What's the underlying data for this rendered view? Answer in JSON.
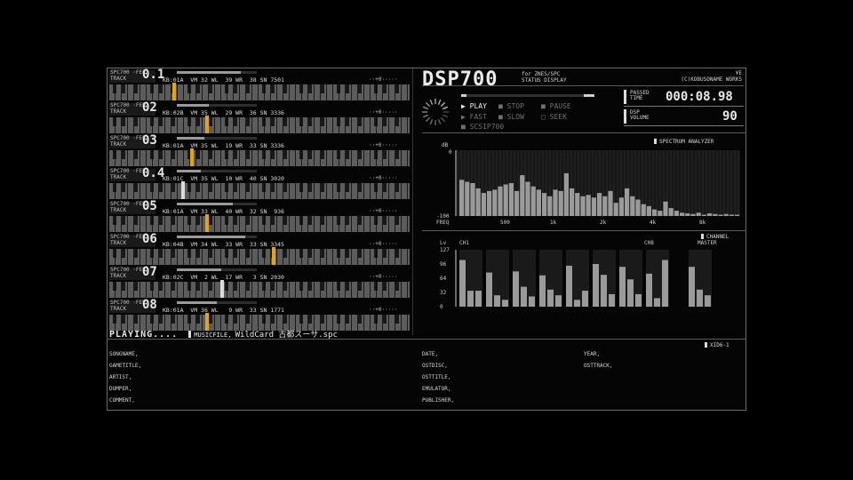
{
  "app": {
    "title": "DSP700",
    "subtitle_line1": "for ZNES/SPC",
    "subtitle_line2": "STATUS DISPLAY",
    "corner_line1": "¥E",
    "corner_line2": "(C)KOBUSONAME WORKS"
  },
  "channels": [
    {
      "label_a": "SPC700 ·FEE",
      "label_b": "TRACK",
      "num": "0.1",
      "info": "KB:01A  VM 32 WL  39 WR  38 SN 7501",
      "pan": "··+0·····",
      "level": 0.8,
      "note_color": "#e3a21a",
      "note_pos": 0.21
    },
    {
      "label_a": "SPC700 ·FEE",
      "label_b": "TRACK",
      "num": "02",
      "info": "KB:02B  VM 35 WL  29 WR  36 SN 3336",
      "pan": "··+0·····",
      "level": 0.4,
      "note_color": "#e3a21a",
      "note_pos": 0.32
    },
    {
      "label_a": "SPC700 ·FEE",
      "label_b": "TRACK",
      "num": "03",
      "info": "KB:01A  VM 35 WL  19 WR  33 SN 3336",
      "pan": "··+0·····",
      "level": 0.35,
      "note_color": "#e3a21a",
      "note_pos": 0.27
    },
    {
      "label_a": "SPC700 ·FEE",
      "label_b": "TRACK",
      "num": "0.4",
      "info": "KB:01C  VM 35 WL  10 WR  40 SN 3020",
      "pan": "··+0·····",
      "level": 0.3,
      "note_color": "#dcdcdc",
      "note_pos": 0.24
    },
    {
      "label_a": "SPC700 ·FEE",
      "label_b": "TRACK",
      "num": "05",
      "info": "KB:01A  VM 33 WL  40 WR  32 SN  936",
      "pan": "··+0·····",
      "level": 0.7,
      "note_color": "#e3a21a",
      "note_pos": 0.32
    },
    {
      "label_a": "SPC700 ·FEE",
      "label_b": "TRACK",
      "num": "06",
      "info": "KB:04B  VM 34 WL  33 WR  33 SN 3345",
      "pan": "··+0·····",
      "level": 0.85,
      "note_color": "#e3a21a",
      "note_pos": 0.54
    },
    {
      "label_a": "SPC700 ·FEE",
      "label_b": "TRACK",
      "num": "07",
      "info": "KB:02C  VM  2 WL  17 WR   3 SN 2030",
      "pan": "··+0·····",
      "level": 0.55,
      "note_color": "#dcdcdc",
      "note_pos": 0.37
    },
    {
      "label_a": "SPC700 ·FEE",
      "label_b": "TRACK",
      "num": "08",
      "info": "KB:01A  VM 36 WL   9 WR  33 SN 1771",
      "pan": "··+0·····",
      "level": 0.5,
      "note_color": "#e3a21a",
      "note_pos": 0.32
    }
  ],
  "status": {
    "state": "PLAYING....",
    "mode": "MUSICFILE",
    "file": "WildCard 古都スーサ.spc"
  },
  "transport": {
    "play": "PLAY",
    "stop": "STOP",
    "pause": "PAUSE",
    "fast": "FAST",
    "slow": "SLOW",
    "seek": "SEEK",
    "scsi": "SCSIP700"
  },
  "time": {
    "passed_label_1": "PASSED",
    "passed_label_2": "TIME",
    "passed_value": "000:08.98",
    "volume_label_1": "DSP",
    "volume_label_2": "VOLUME",
    "volume_value": "90"
  },
  "spectrum": {
    "label": "SPECTRUM ANALYZER",
    "db_label": "dB",
    "top_tick": "0",
    "bottom_tick": "-100",
    "freq_label": "FREQ",
    "freq_ticks": [
      "500",
      "1k",
      "2k",
      "4k",
      "8k"
    ],
    "values": [
      55,
      52,
      50,
      42,
      35,
      38,
      40,
      45,
      48,
      50,
      38,
      62,
      52,
      45,
      40,
      35,
      30,
      40,
      38,
      65,
      42,
      35,
      30,
      32,
      28,
      35,
      30,
      38,
      20,
      28,
      42,
      30,
      25,
      18,
      15,
      10,
      8,
      22,
      12,
      8,
      5,
      4,
      3,
      5,
      2,
      4,
      3,
      2,
      3,
      2,
      2
    ]
  },
  "levels": {
    "channel_label": "CHANNEL",
    "ch1_label": "CH1",
    "ch8_label": "CH8",
    "master_label": "MASTER",
    "lv_label": "Lv",
    "ticks": [
      "127",
      "96",
      "64",
      "32",
      "0"
    ],
    "bars": [
      [
        82,
        28,
        28
      ],
      [
        60,
        20,
        12
      ],
      [
        62,
        35,
        18
      ],
      [
        55,
        30,
        20
      ],
      [
        72,
        12,
        28
      ],
      [
        75,
        56,
        22
      ],
      [
        70,
        48,
        22
      ],
      [
        58,
        15,
        82
      ],
      [
        70,
        30,
        20
      ]
    ]
  },
  "tags": {
    "panel_label": "XID6-1",
    "songname": "SONGNAME",
    "gametitle": "GAMETITLE",
    "artist": "ARTIST",
    "dumper": "DUMPER",
    "comment": "COMMENT",
    "date": "DATE",
    "ostdisc": "OSTDISC",
    "osttitle": "OSTTITLE",
    "emulator": "EMULATOR",
    "publisher": "PUBLISHER",
    "year": "YEAR",
    "osttrack": "OSTTRACK"
  }
}
